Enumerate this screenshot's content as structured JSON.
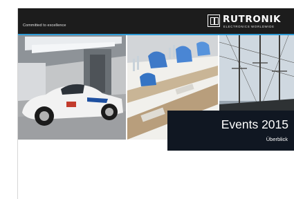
{
  "header": {
    "tagline": "Committed to excellence",
    "brand_name": "RUTRONIK",
    "brand_subtitle": "ELECTRONICS WORLDWIDE",
    "logo_icon": "rutronik-logo-icon"
  },
  "cover": {
    "title": "Events 2015",
    "subtitle": "Überblick"
  },
  "photos": [
    {
      "name": "race-car-photo"
    },
    {
      "name": "trade-show-table-photo"
    },
    {
      "name": "tall-ship-photo"
    }
  ],
  "colors": {
    "header_bg": "#1c1c1c",
    "accent": "#2e9bd6",
    "title_box_bg": "#101722",
    "page_bg": "#ffffff"
  }
}
